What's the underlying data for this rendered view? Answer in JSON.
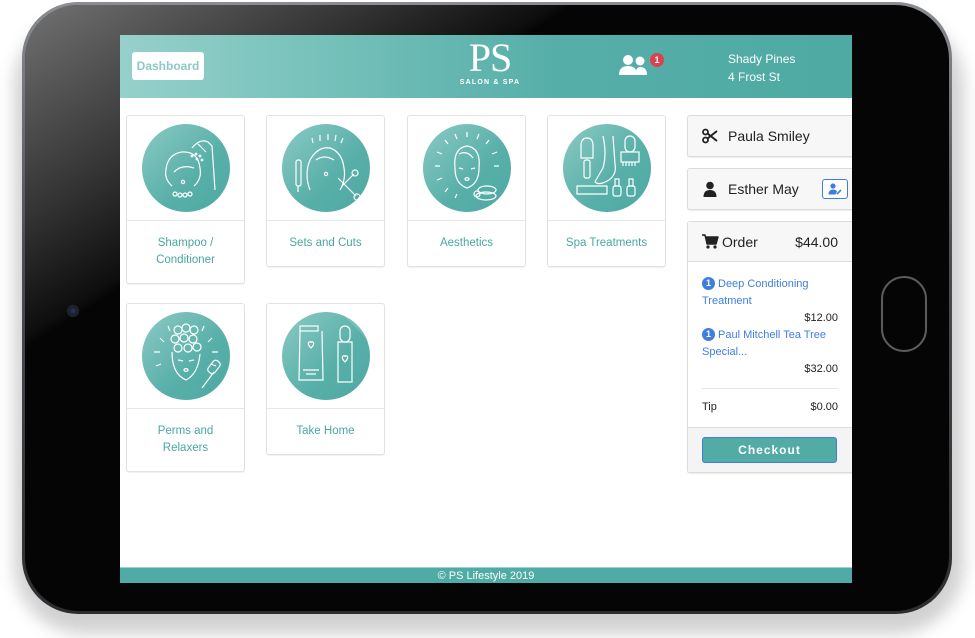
{
  "header": {
    "dashboard_label": "Dashboard",
    "logo_main": "PS",
    "logo_sub": "SALON & SPA",
    "users_badge_count": "1",
    "location_name": "Shady Pines",
    "location_address": "4 Frost St"
  },
  "categories": [
    {
      "label": "Shampoo / Conditioner",
      "icon": "shampoo-shower-icon"
    },
    {
      "label": "Sets and Cuts",
      "icon": "haircut-scissors-icon"
    },
    {
      "label": "Aesthetics",
      "icon": "face-spa-icon"
    },
    {
      "label": "Spa Treatments",
      "icon": "nail-foot-care-icon"
    },
    {
      "label": "Perms and Relaxers",
      "icon": "curlers-brush-icon"
    },
    {
      "label": "Take Home",
      "icon": "products-bottles-icon"
    }
  ],
  "sidebar": {
    "stylist_name": "Paula Smiley",
    "client_name": "Esther May",
    "order_label": "Order",
    "order_total": "$44.00",
    "items": [
      {
        "qty": "1",
        "name": "Deep Conditioning Treatment",
        "price": "$12.00"
      },
      {
        "qty": "1",
        "name": "Paul Mitchell Tea Tree Special...",
        "price": "$32.00"
      }
    ],
    "tip_label": "Tip",
    "tip_value": "$0.00",
    "checkout_label": "Checkout"
  },
  "footer": {
    "text": "© PS Lifestyle 2019"
  },
  "colors": {
    "brand_teal": "#52aca5",
    "link_blue": "#3f7ee0",
    "badge_red": "#d9434f"
  }
}
